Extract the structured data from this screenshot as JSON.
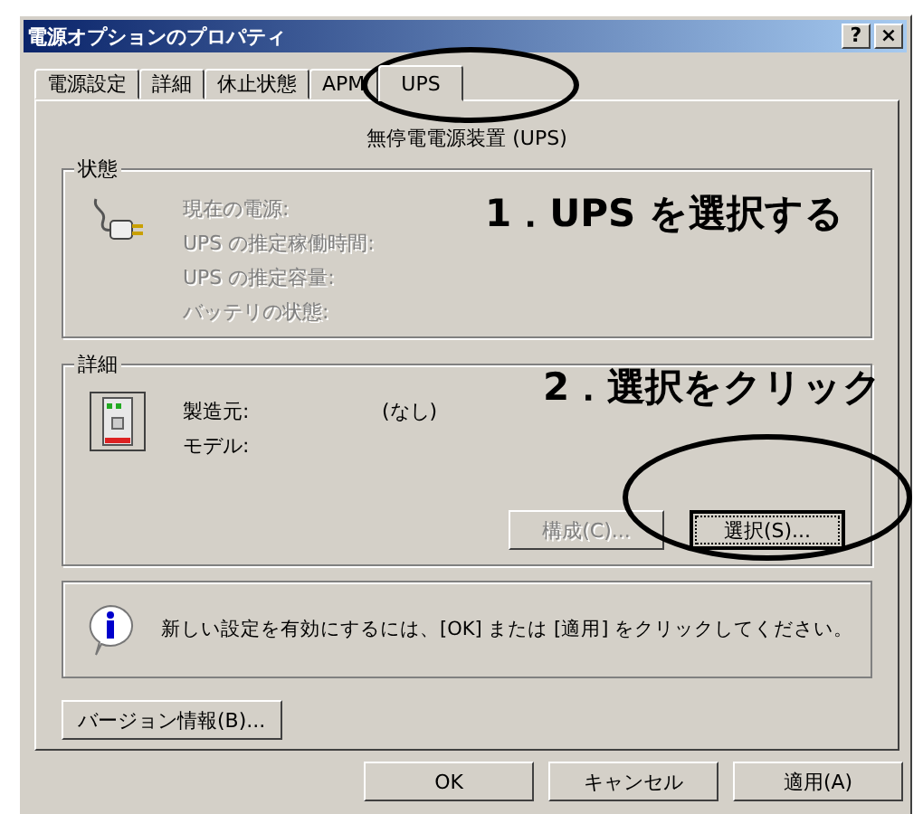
{
  "window": {
    "title": "電源オプションのプロパティ",
    "title_buttons": [
      "?",
      "×"
    ]
  },
  "tabs": [
    {
      "label": "電源設定",
      "selected": false
    },
    {
      "label": "詳細",
      "selected": false
    },
    {
      "label": "休止状態",
      "selected": false
    },
    {
      "label": "APM",
      "selected": false
    },
    {
      "label": "UPS",
      "selected": true
    }
  ],
  "panel": {
    "heading": "無停電電源装置 (UPS)",
    "status_group": {
      "legend": "状態",
      "items": [
        {
          "label": "現在の電源:",
          "disabled": true
        },
        {
          "label": "UPS の推定稼働時間:",
          "disabled": true
        },
        {
          "label": "UPS の推定容量:",
          "disabled": true
        },
        {
          "label": "バッテリの状態:",
          "disabled": true
        }
      ]
    },
    "details_group": {
      "legend": "詳細",
      "fields": [
        {
          "label": "製造元:",
          "value": "(なし)"
        },
        {
          "label": "モデル:"
        }
      ],
      "buttons": [
        {
          "label": "構成(C)...",
          "disabled": true,
          "focused": false
        },
        {
          "label": "選択(S)...",
          "disabled": false,
          "focused": true
        }
      ]
    },
    "info_message": "新しい設定を有効にするには、[OK] または [適用] をクリックしてください。",
    "version_button": "バージョン情報(B)..."
  },
  "buttons": [
    "OK",
    "キャンセル",
    "適用(A)"
  ],
  "annotations": [
    {
      "text": "1．UPS を選択する"
    },
    {
      "text": "2．選択をクリック"
    }
  ]
}
